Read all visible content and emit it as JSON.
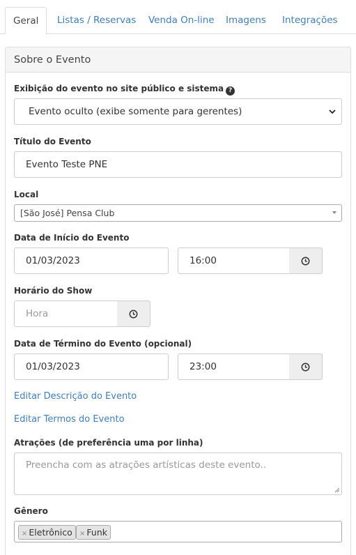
{
  "tabs": [
    {
      "label": "Geral"
    },
    {
      "label": "Listas / Reservas"
    },
    {
      "label": "Venda On-line"
    },
    {
      "label": "Imagens"
    },
    {
      "label": "Integrações"
    }
  ],
  "panel": {
    "title": "Sobre o Evento"
  },
  "visibility": {
    "label": "Exibição do evento no site público e sistema",
    "help_icon": "question-circle-icon",
    "value": "Evento oculto (exibe somente para gerentes)"
  },
  "title_field": {
    "label": "Título do Evento",
    "value": "Evento Teste PNE"
  },
  "location": {
    "label": "Local",
    "value": "[São José] Pensa Club"
  },
  "start": {
    "label": "Data de Início do Evento",
    "date": "01/03/2023",
    "time": "16:00",
    "icon": "clock-icon"
  },
  "show_time": {
    "label": "Horário do Show",
    "placeholder": "Hora",
    "icon": "clock-icon"
  },
  "end": {
    "label": "Data de Término do Evento (opcional)",
    "date": "01/03/2023",
    "time": "23:00",
    "icon": "clock-icon"
  },
  "links": {
    "edit_description": "Editar Descrição do Evento",
    "edit_terms": "Editar Termos do Evento"
  },
  "attractions": {
    "label": "Atrações (de preferência uma por linha)",
    "placeholder": "Preencha com as atrações artísticas deste evento.."
  },
  "genre": {
    "label": "Gênero",
    "tags": [
      {
        "label": "Eletrônico"
      },
      {
        "label": "Funk"
      }
    ]
  }
}
